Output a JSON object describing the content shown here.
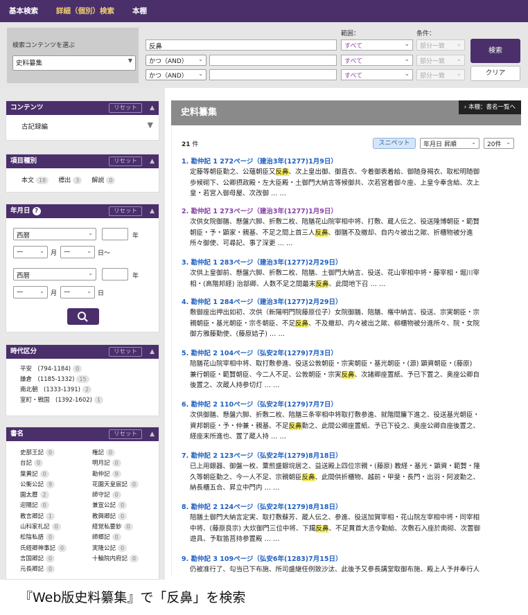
{
  "nav": {
    "tabs": [
      "基本検索",
      "詳細（個別）検索",
      "本棚"
    ]
  },
  "search": {
    "content_label": "検索コンテンツを選ぶ",
    "content_value": "史料纂集",
    "scope_header": "範囲：",
    "cond_header": "条件：",
    "keyword": "反鼻",
    "op1": "かつ（AND）",
    "op2": "かつ（AND）",
    "scope": [
      "すべて",
      "すべて",
      "すべて"
    ],
    "cond": [
      "部分一致",
      "部分一致",
      "部分一致"
    ],
    "search_btn": "検索",
    "clear_btn": "クリア"
  },
  "sidebar": {
    "reset": "リセット",
    "contents": {
      "title": "コンテンツ",
      "item": "古記録編"
    },
    "kind": {
      "title": "項目種別",
      "items": [
        {
          "label": "本文",
          "count": "18"
        },
        {
          "label": "標出",
          "count": "3"
        },
        {
          "label": "解説",
          "count": "0"
        }
      ]
    },
    "date": {
      "title": "年月日",
      "era1": "西暦",
      "era2": "西暦",
      "year": "年",
      "month": "月",
      "day_from": "日〜",
      "day": "日",
      "dash": "—"
    },
    "period": {
      "title": "時代区分",
      "items": [
        {
          "label": "平安　(794-1184)",
          "count": "0"
        },
        {
          "label": "鎌倉　(1185-1332)",
          "count": "15"
        },
        {
          "label": "南北朝　(1333-1391)",
          "count": "2"
        },
        {
          "label": "室町・戦国　(1392-1602)",
          "count": "1"
        }
      ]
    },
    "books": {
      "title": "書名",
      "left": [
        {
          "label": "史部王記",
          "count": "0"
        },
        {
          "label": "台記",
          "count": "0"
        },
        {
          "label": "葉黄記",
          "count": "0"
        },
        {
          "label": "公衡公記",
          "count": "9"
        },
        {
          "label": "園太暦",
          "count": "2"
        },
        {
          "label": "迎陽記",
          "count": "0"
        },
        {
          "label": "教言卿記",
          "count": "1"
        },
        {
          "label": "山科家礼記",
          "count": "0"
        },
        {
          "label": "松陰私語",
          "count": "0"
        },
        {
          "label": "氏経卿神事記",
          "count": "0"
        },
        {
          "label": "言国卿記",
          "count": "0"
        },
        {
          "label": "元長卿記",
          "count": "0"
        }
      ],
      "right": [
        {
          "label": "権記",
          "count": "0"
        },
        {
          "label": "明月記",
          "count": "0"
        },
        {
          "label": "勘仲記",
          "count": "9"
        },
        {
          "label": "花園天皇宸記",
          "count": "0"
        },
        {
          "label": "師守記",
          "count": "0"
        },
        {
          "label": "兼宣公記",
          "count": "0"
        },
        {
          "label": "教興卿記",
          "count": "0"
        },
        {
          "label": "経覚私要鈔",
          "count": "0"
        },
        {
          "label": "師郷記",
          "count": "0"
        },
        {
          "label": "実隆公記",
          "count": "0"
        },
        {
          "label": "十輪院内府記",
          "count": "0"
        }
      ]
    }
  },
  "main": {
    "title": "史料纂集",
    "honsho": "本棚：書名一覧へ",
    "count": "21",
    "count_unit": "件",
    "snippet_btn": "スニペット",
    "sort": "年月日 昇順",
    "perpage": "20件",
    "results": [
      {
        "title": "1. 勘仲記 1 272ページ（建治3年(1277)1月9日）",
        "visited": false,
        "lines": [
          [
            "定藤等朝臣勤之、公蘊朝臣又",
            "反鼻",
            "、次上皇出御、御直衣、令着御表着給、御随身褐衣、取松明随御"
          ],
          [
            "歩候砌下、公卿摂政殿・左大臣殿・土御門大納言等候御共、次若宮着御々座、上皇令奉含給、次上",
            "",
            ""
          ],
          [
            "皇・若宮入御母屋、次改御 … …",
            "",
            ""
          ]
        ]
      },
      {
        "title": "2. 勘仲記 1 273ページ（建治3年(1277)1月9日）",
        "visited": true,
        "lines": [
          [
            "次供女院御膳、懸盤六脚、折敷二枚、陪膳花山院宰相中将、打敷、蔵人伝之、役送隆博朝臣・範賢",
            "",
            ""
          ],
          [
            "朝臣・予・顕家・親基、不足之間上首三人",
            "反鼻",
            "、御膳不及撤却、自内々被出之歟、折櫃物被分進"
          ],
          [
            "所々御使、可尋記、事了深更 … …",
            "",
            ""
          ]
        ]
      },
      {
        "title": "3. 勘仲記 1 283ページ（建治3年(1277)2月29日）",
        "visited": false,
        "lines": [
          [
            "次供上皇御前、懸盤六脚、折敷二枚、陪膳、土御門大納言、役送、花山宰相中将・藤宰相・堀川宰",
            "",
            ""
          ],
          [
            "相・(高階邦経) 治部卿、人数不足之間最末",
            "反鼻",
            "、此間地下召 … …"
          ]
        ]
      },
      {
        "title": "4. 勘仲記 1 284ページ（建治3年(1277)2月29日）",
        "visited": false,
        "lines": [
          [
            "敷御座出押出如初、次供（新陽明門院藤原位子）女院御膳、陪膳、権中納言、役送、宗実朝臣・宗",
            "",
            ""
          ],
          [
            "親朝臣・基光朝臣・宗冬朝臣、不足",
            "反鼻",
            "、不及撤却、内々被出之歟、柳櫃物被分進所々、院・女院"
          ],
          [
            "御方雅藤勤使、(藤原姞子) … …",
            "",
            ""
          ]
        ]
      },
      {
        "title": "5. 勘仲記 2 104ページ（弘安2年(1279)7月3日）",
        "visited": false,
        "lines": [
          [
            "陪膳花山院宰相中将、取打敷参進、役送公敦朝臣・宗実朝臣・基光朝臣・(源) 顕資朝臣・(藤原)",
            "",
            ""
          ],
          [
            "兼行朝臣・範賢朝臣、今二人不足、公敦朝臣・宗実",
            "反鼻",
            "、次諸卿座置紙、予已下置之、奥座公卿自"
          ],
          [
            "後置之、次蔵人持参切灯 … …",
            "",
            ""
          ]
        ]
      },
      {
        "title": "6. 勘仲記 2 110ページ（弘安2年(1279)7月7日）",
        "visited": false,
        "lines": [
          [
            "次供御膳、懸盤六脚、折敷二枚、陪膳三条宰相中将取打敷参進、就階間簾下進之、役送基光朝臣・",
            "",
            ""
          ],
          [
            "資邦朝臣・予・仲兼・親基、不足",
            "反鼻",
            "勤之、此間公卿座置紙、予已下役之、奥座公卿自座後置之、"
          ],
          [
            "経座末所進也、置了蔵人持 … …",
            "",
            ""
          ]
        ]
      },
      {
        "title": "7. 勘仲記 2 123ページ（弘安2年(1279)8月18日）",
        "visited": false,
        "lines": [
          [
            "已上用銀器、御盤一枚、粟煎盛銀垸居之、益送殿上四位宗親・(藤原) 教経・基光・顕資・範賢・隆",
            "",
            ""
          ],
          [
            "久等朝臣勤之、今一人不足、宗親朝臣",
            "反鼻",
            "、此間供折櫃物、越前・甲斐・長門・出羽・阿波勤之、"
          ],
          [
            "納長櫃五合、昇立中門内 … …",
            "",
            ""
          ]
        ]
      },
      {
        "title": "8. 勘仲記 2 124ページ（弘安2年(1279)8月18日）",
        "visited": false,
        "lines": [
          [
            "陪膳土御門大納言定実、取打敷蘇芳、蔵人伝之、参進、役送加賀宰相・花山院左宰相中将・同宰相",
            "",
            ""
          ],
          [
            "中将、(藤原良宗) 大炊御門三位中将、下臈",
            "反鼻",
            "、不足貫首大丞令勤給、次敷石入座於南砌、次置御"
          ],
          [
            "遊具、予取笛莒持参置殿 … …",
            "",
            ""
          ]
        ]
      },
      {
        "title": "9. 勘仲記 3 109ページ（弘安6年(1283)7月15日）",
        "visited": false,
        "lines": [
          [
            "仍被准行了、勾当已下布施、所司盛継任例致沙汰、此後予又参長講堂取御布施、殿上人予并奉行人",
            "",
            ""
          ]
        ]
      }
    ]
  },
  "caption": "『Web版史料纂集』で「反鼻」を検索"
}
